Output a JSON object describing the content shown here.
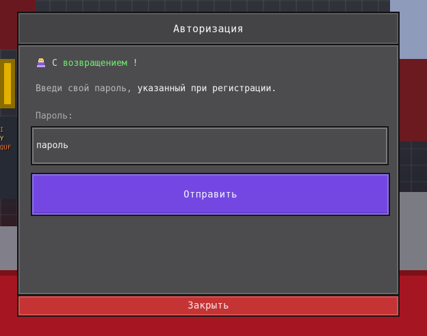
{
  "dialog": {
    "title": "Авторизация",
    "welcome": {
      "prefix": "С ",
      "highlight": "возвращением",
      "suffix": "!"
    },
    "instructions": {
      "part1": "Введи свой пароль, ",
      "part2": "указанный при регистрации."
    },
    "password": {
      "label": "Пароль:",
      "value": "",
      "placeholder": "пароль"
    },
    "submit_label": "Отправить",
    "close_label": "Закрыть",
    "background_text": {
      "line1": "I",
      "line2": "Y",
      "line3": "QUF"
    }
  }
}
